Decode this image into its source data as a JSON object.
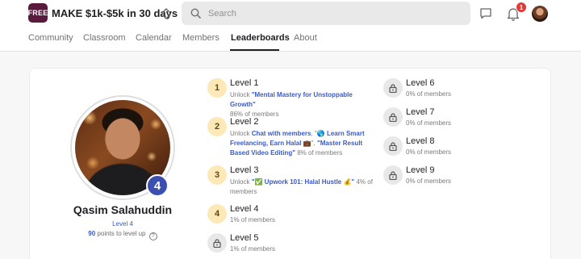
{
  "header": {
    "logo_text": "FREE",
    "group_title": "MAKE $1k-$5k in 30 days",
    "search_placeholder": "Search",
    "notification_count": "1"
  },
  "nav": {
    "tabs": [
      {
        "label": "Community"
      },
      {
        "label": "Classroom"
      },
      {
        "label": "Calendar"
      },
      {
        "label": "Members"
      },
      {
        "label": "Leaderboards"
      },
      {
        "label": "About"
      }
    ],
    "active_tab": "Leaderboards"
  },
  "profile": {
    "name": "Qasim Salahuddin",
    "level_badge": "4",
    "level_label": "Level 4",
    "points_to_level_up": "90",
    "points_suffix": "points to level up"
  },
  "levels": [
    {
      "title": "Level 1",
      "number": "1",
      "locked": false,
      "desc_prefix": "Unlock ",
      "desc_links": [
        "\"Mental Mastery for Unstoppable Growth\""
      ],
      "desc_suffix": "",
      "percent": "86% of members"
    },
    {
      "title": "Level 2",
      "number": "2",
      "locked": false,
      "desc_prefix": "Unlock ",
      "desc_links": [
        "Chat with members",
        "🌎 Learn Smart Freelancing, Earn Halal 💼",
        "\"Master Result Based Video Editing\""
      ],
      "desc_suffix": "8% of members"
    },
    {
      "title": "Level 3",
      "number": "3",
      "locked": false,
      "desc_prefix": "Unlock ",
      "desc_links": [
        "\"✅ Upwork 101: Halal Hustle 💰\""
      ],
      "desc_suffix": "4% of members"
    },
    {
      "title": "Level 4",
      "number": "4",
      "locked": false,
      "percent": "1% of members"
    },
    {
      "title": "Level 5",
      "number": "5",
      "locked": true,
      "percent": "1% of members"
    },
    {
      "title": "Level 6",
      "number": "6",
      "locked": true,
      "percent": "0% of members"
    },
    {
      "title": "Level 7",
      "number": "7",
      "locked": true,
      "percent": "0% of members"
    },
    {
      "title": "Level 8",
      "number": "8",
      "locked": true,
      "percent": "0% of members"
    },
    {
      "title": "Level 9",
      "number": "9",
      "locked": true,
      "percent": "0% of members"
    }
  ],
  "colors": {
    "accent_link": "#3b5bc4",
    "level_badge": "#3b4fb0",
    "unlocked_circle": "#fde9b8",
    "notification": "#e53935"
  }
}
